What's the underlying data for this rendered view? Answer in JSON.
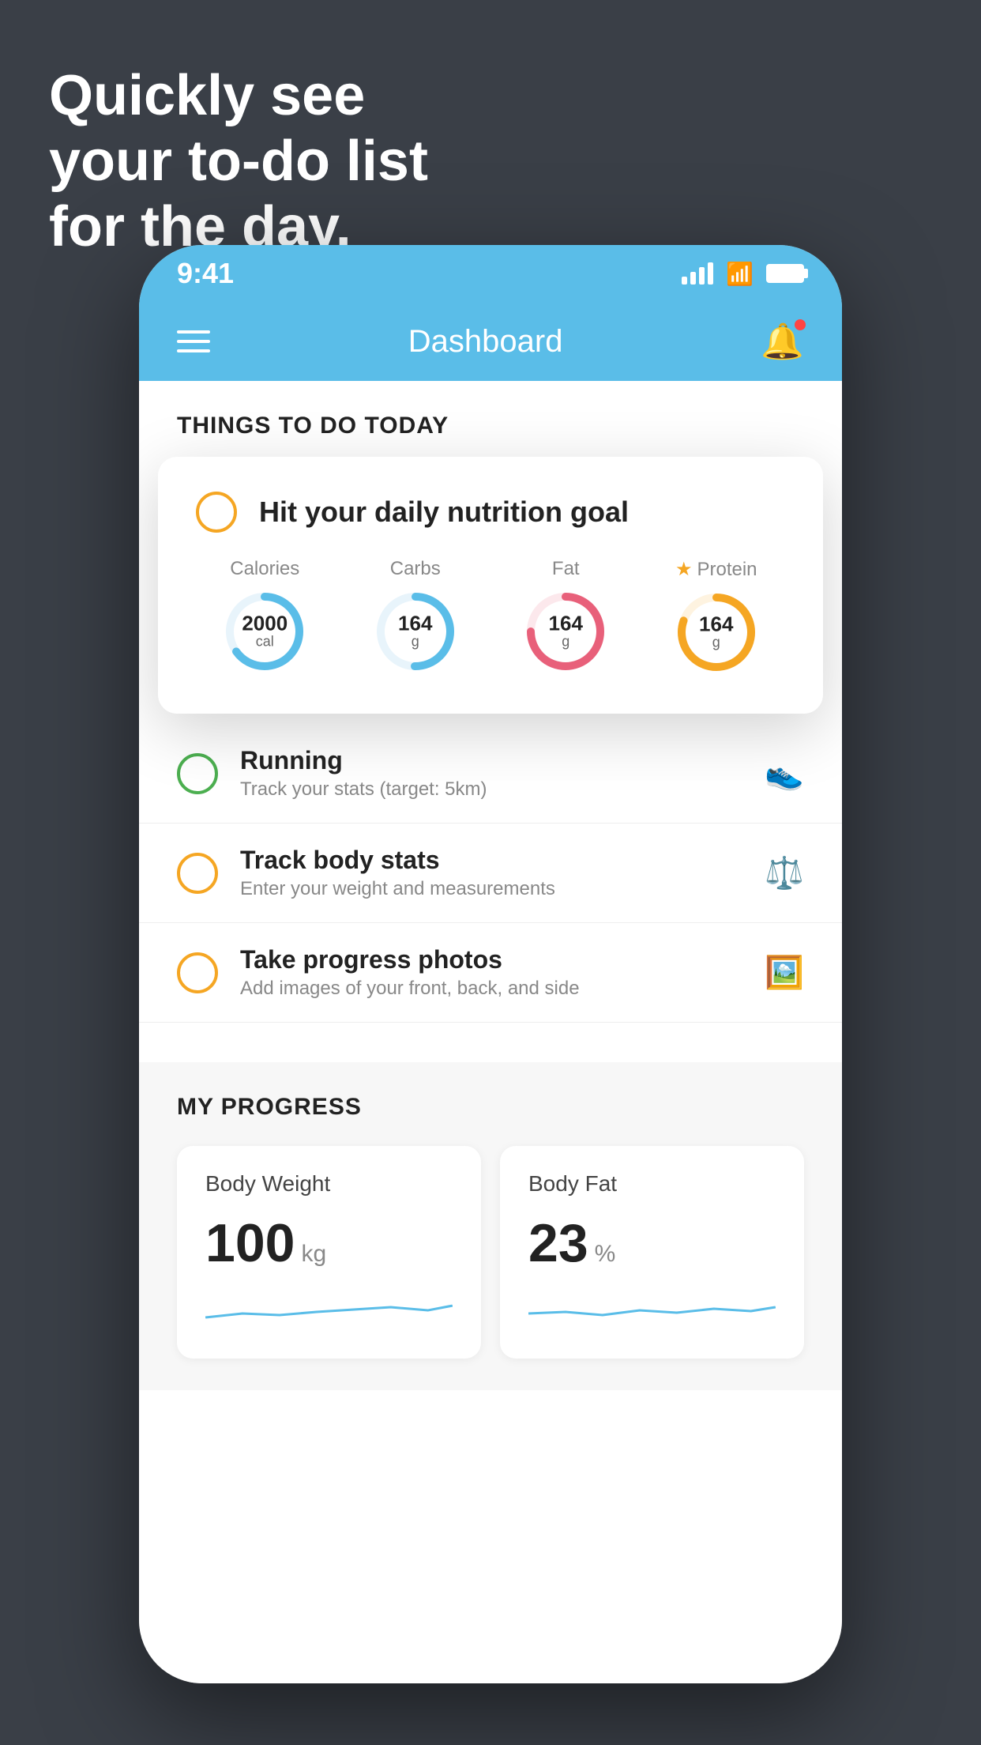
{
  "headline": {
    "line1": "Quickly see",
    "line2": "your to-do list",
    "line3": "for the day."
  },
  "status_bar": {
    "time": "9:41"
  },
  "header": {
    "title": "Dashboard"
  },
  "things_to_do": {
    "section_title": "THINGS TO DO TODAY"
  },
  "nutrition_card": {
    "checkbox_color": "#f5a623",
    "title": "Hit your daily nutrition goal",
    "macros": [
      {
        "label": "Calories",
        "value": "2000",
        "unit": "cal",
        "color": "#5abde8",
        "progress": 0.65
      },
      {
        "label": "Carbs",
        "value": "164",
        "unit": "g",
        "color": "#5abde8",
        "progress": 0.5
      },
      {
        "label": "Fat",
        "value": "164",
        "unit": "g",
        "color": "#e8607a",
        "progress": 0.75
      },
      {
        "label": "Protein",
        "value": "164",
        "unit": "g",
        "color": "#f5a623",
        "progress": 0.8,
        "starred": true
      }
    ]
  },
  "todo_items": [
    {
      "circle_color": "green",
      "title": "Running",
      "subtitle": "Track your stats (target: 5km)",
      "icon": "shoe"
    },
    {
      "circle_color": "yellow",
      "title": "Track body stats",
      "subtitle": "Enter your weight and measurements",
      "icon": "scale"
    },
    {
      "circle_color": "yellow",
      "title": "Take progress photos",
      "subtitle": "Add images of your front, back, and side",
      "icon": "photo"
    }
  ],
  "progress": {
    "section_title": "MY PROGRESS",
    "cards": [
      {
        "title": "Body Weight",
        "value": "100",
        "unit": "kg"
      },
      {
        "title": "Body Fat",
        "value": "23",
        "unit": "%"
      }
    ]
  }
}
